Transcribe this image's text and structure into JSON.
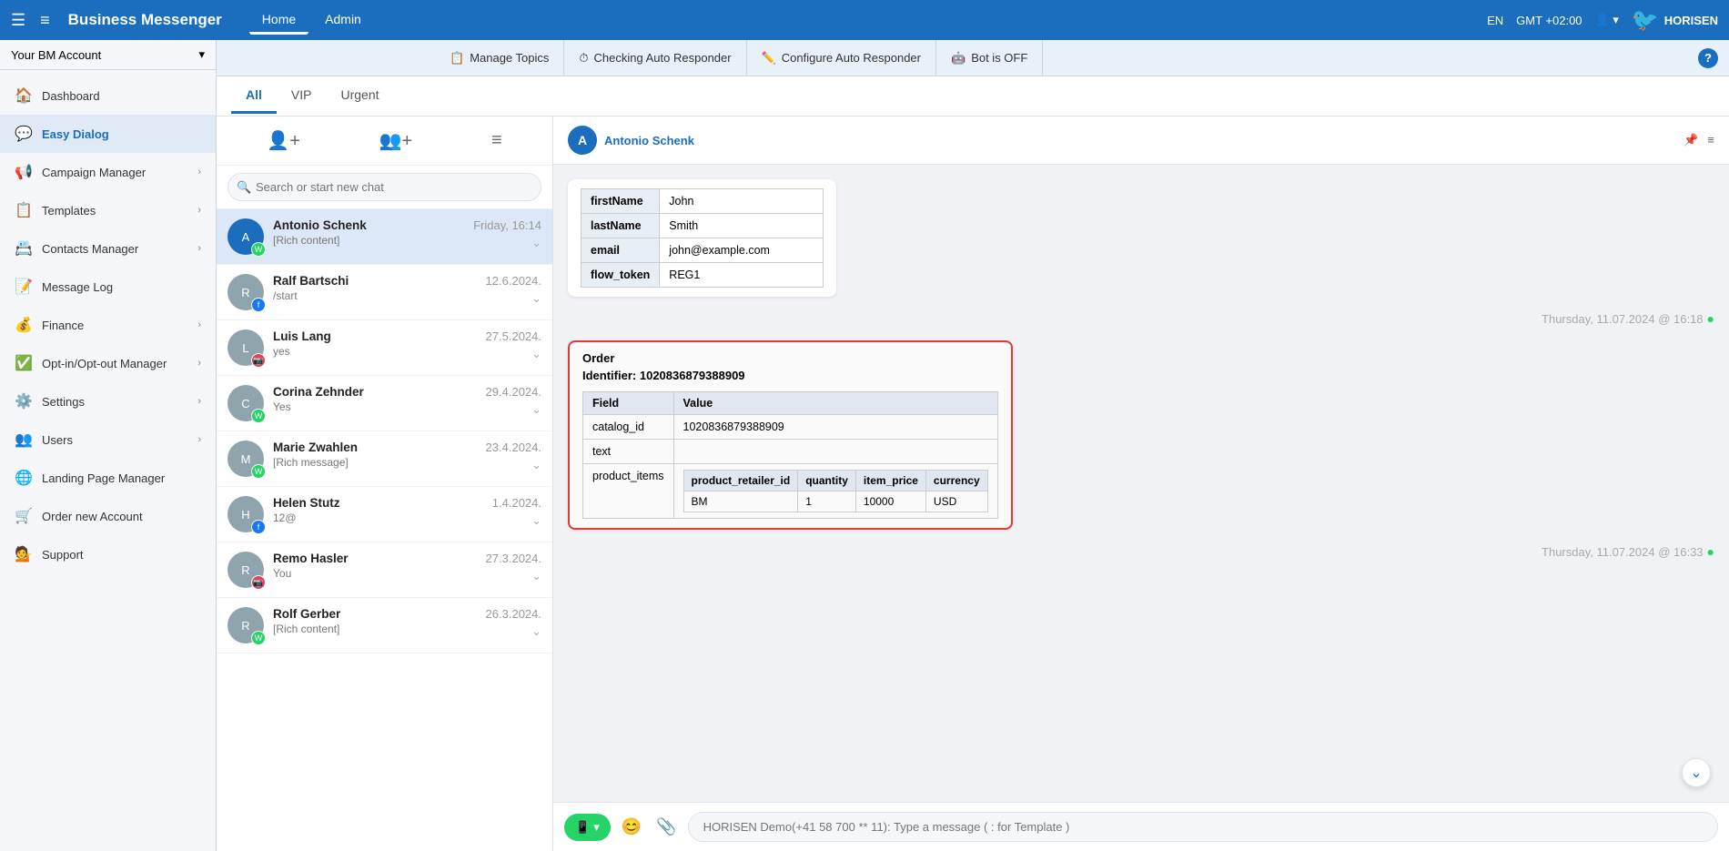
{
  "topnav": {
    "brand": "Business Messenger",
    "nav_home": "Home",
    "nav_admin": "Admin",
    "lang": "EN",
    "timezone": "GMT +02:00",
    "logo": "HORISEN"
  },
  "subnav": {
    "manage_topics": "Manage Topics",
    "checking_auto_responder": "Checking Auto Responder",
    "configure_auto_responder": "Configure Auto Responder",
    "bot_is_off": "Bot is OFF"
  },
  "account_selector": {
    "label": "Your BM Account"
  },
  "sidebar": {
    "items": [
      {
        "id": "dashboard",
        "label": "Dashboard",
        "icon": "🏠",
        "has_arrow": false
      },
      {
        "id": "easy-dialog",
        "label": "Easy Dialog",
        "icon": "💬",
        "has_arrow": false
      },
      {
        "id": "campaign-manager",
        "label": "Campaign Manager",
        "icon": "📢",
        "has_arrow": true
      },
      {
        "id": "templates",
        "label": "Templates",
        "icon": "📋",
        "has_arrow": true
      },
      {
        "id": "contacts-manager",
        "label": "Contacts Manager",
        "icon": "📇",
        "has_arrow": true
      },
      {
        "id": "message-log",
        "label": "Message Log",
        "icon": "📝",
        "has_arrow": false
      },
      {
        "id": "finance",
        "label": "Finance",
        "icon": "💰",
        "has_arrow": true
      },
      {
        "id": "opt-in-out",
        "label": "Opt-in/Opt-out Manager",
        "icon": "✅",
        "has_arrow": true
      },
      {
        "id": "settings",
        "label": "Settings",
        "icon": "⚙️",
        "has_arrow": true
      },
      {
        "id": "users",
        "label": "Users",
        "icon": "👥",
        "has_arrow": true
      },
      {
        "id": "landing-page",
        "label": "Landing Page Manager",
        "icon": "🌐",
        "has_arrow": false
      },
      {
        "id": "order-account",
        "label": "Order new Account",
        "icon": "🛒",
        "has_arrow": false
      },
      {
        "id": "support",
        "label": "Support",
        "icon": "💁",
        "has_arrow": false
      }
    ]
  },
  "tabs": {
    "all": "All",
    "vip": "VIP",
    "urgent": "Urgent"
  },
  "search": {
    "placeholder": "Search or start new chat"
  },
  "chat_list": [
    {
      "name": "Antonio Schenk",
      "preview": "[Rich content]",
      "date": "Friday, 16:14",
      "platform": "whatsapp",
      "active": true,
      "avatar_letter": "A"
    },
    {
      "name": "Ralf Bartschi",
      "preview": "/start",
      "date": "12.6.2024.",
      "platform": "facebook",
      "active": false,
      "avatar_letter": "R"
    },
    {
      "name": "Luis Lang",
      "preview": "yes",
      "date": "27.5.2024.",
      "platform": "instagram",
      "active": false,
      "avatar_letter": "L"
    },
    {
      "name": "Corina Zehnder",
      "preview": "Yes",
      "date": "29.4.2024.",
      "platform": "whatsapp",
      "active": false,
      "avatar_letter": "C"
    },
    {
      "name": "Marie Zwahlen",
      "preview": "[Rich message]",
      "date": "23.4.2024.",
      "platform": "whatsapp",
      "active": false,
      "avatar_letter": "M"
    },
    {
      "name": "Helen Stutz",
      "preview": "12@",
      "date": "1.4.2024.",
      "platform": "facebook",
      "active": false,
      "avatar_letter": "H"
    },
    {
      "name": "Remo Hasler",
      "preview": "You",
      "date": "27.3.2024.",
      "platform": "instagram",
      "active": false,
      "avatar_letter": "R"
    },
    {
      "name": "Rolf Gerber",
      "preview": "[Rich content]",
      "date": "26.3.2024.",
      "platform": "whatsapp",
      "active": false,
      "avatar_letter": "R"
    }
  ],
  "chat_detail": {
    "contact_name": "Antonio Schenk",
    "message1": {
      "fields": [
        {
          "key": "firstName",
          "value": "John"
        },
        {
          "key": "lastName",
          "value": "Smith"
        },
        {
          "key": "email",
          "value": "john@example.com"
        },
        {
          "key": "flow_token",
          "value": "REG1"
        }
      ],
      "timestamp": "Thursday, 11.07.2024 @ 16:18"
    },
    "message2": {
      "order_title": "Order",
      "order_identifier_label": "Identifier:",
      "order_identifier_value": "1020836879388909",
      "table_headers": [
        "Field",
        "Value"
      ],
      "rows": [
        {
          "field": "catalog_id",
          "value": "1020836879388909"
        },
        {
          "field": "text",
          "value": ""
        },
        {
          "field": "product_items",
          "value": ""
        }
      ],
      "product_items_headers": [
        "product_retailer_id",
        "quantity",
        "item_price",
        "currency"
      ],
      "product_items_rows": [
        {
          "product_retailer_id": "BM",
          "quantity": "1",
          "item_price": "10000",
          "currency": "USD"
        }
      ],
      "timestamp": "Thursday, 11.07.2024 @ 16:33"
    },
    "input_placeholder": "HORISEN Demo(+41 58 700 ** 11): Type a message ( : for Template )"
  }
}
